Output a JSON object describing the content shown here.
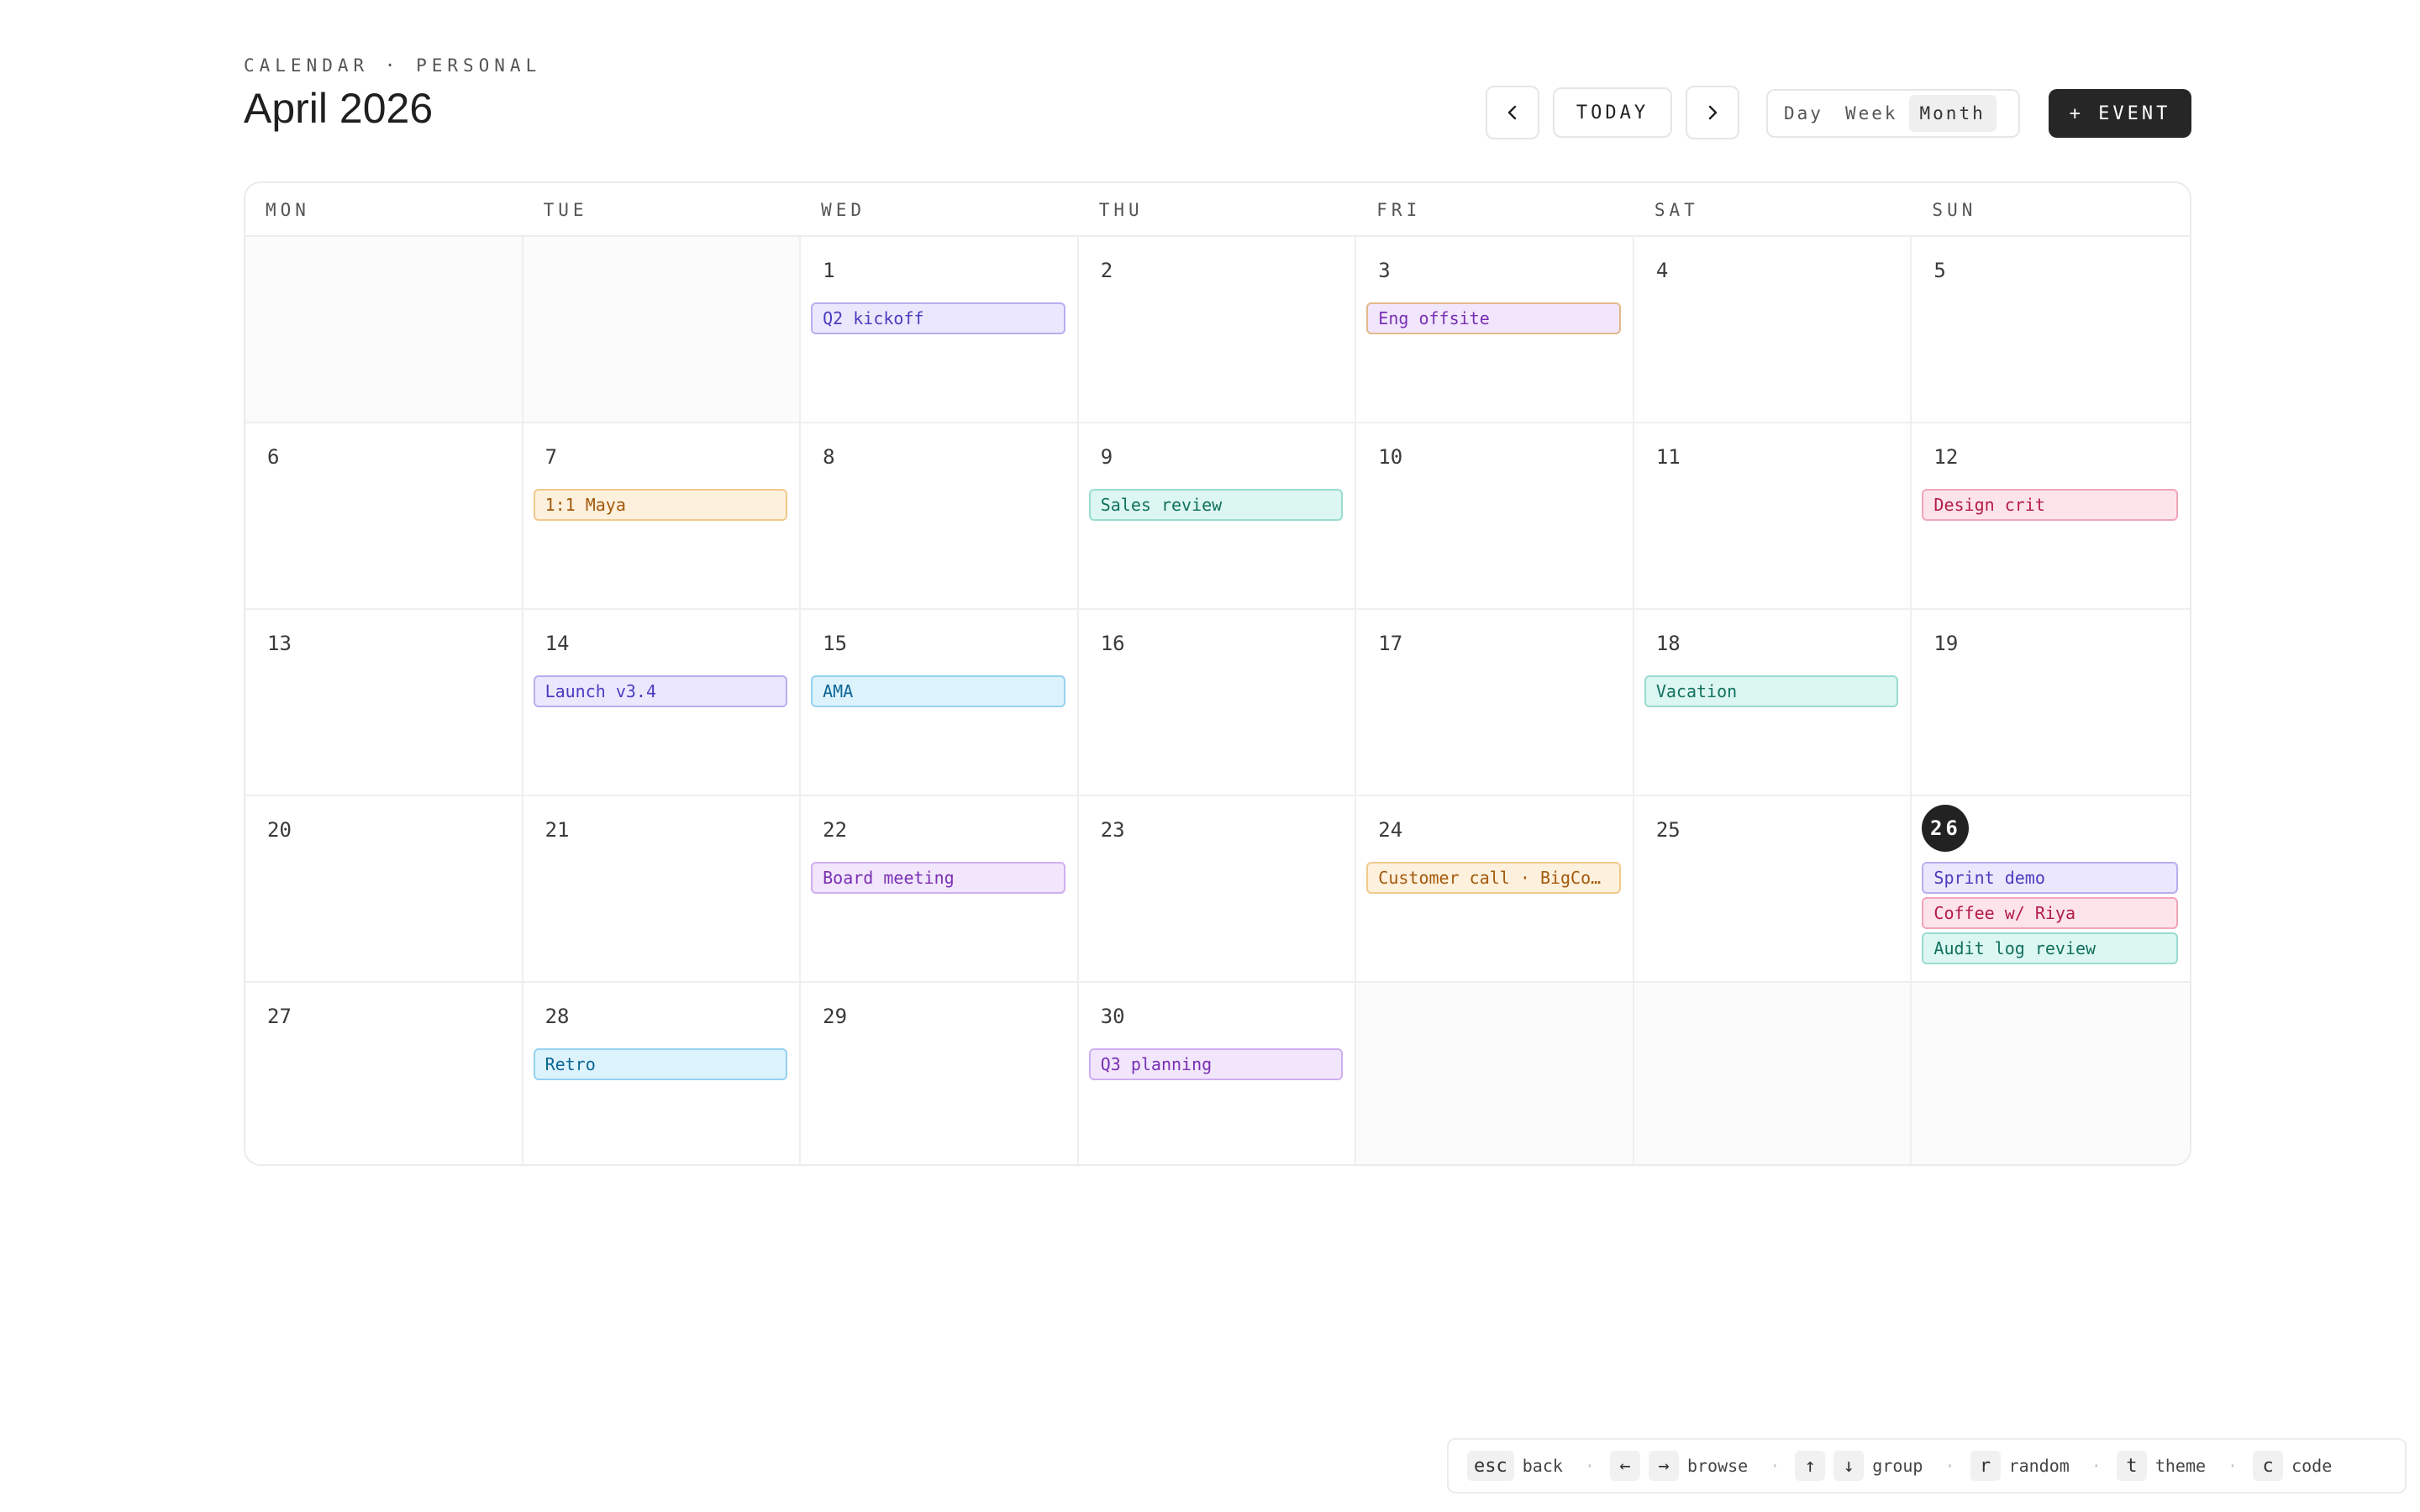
{
  "header": {
    "eyebrow": "CALENDAR · PERSONAL",
    "title": "April 2026"
  },
  "toolbar": {
    "prev_icon": "chevron-left-icon",
    "today_label": "TODAY",
    "next_icon": "chevron-right-icon",
    "views": [
      "Day",
      "Week",
      "Month"
    ],
    "active_view": "Month",
    "add_label": "+ EVENT"
  },
  "calendar": {
    "weekdays": [
      "MON",
      "TUE",
      "WED",
      "THU",
      "FRI",
      "SAT",
      "SUN"
    ],
    "today": "26",
    "weeks": [
      [
        {
          "day": "",
          "out": true,
          "events": []
        },
        {
          "day": "",
          "out": true,
          "events": []
        },
        {
          "day": "1",
          "events": [
            {
              "title": "Q2 kickoff",
              "color": "indigo"
            }
          ]
        },
        {
          "day": "2",
          "events": []
        },
        {
          "day": "3",
          "events": [
            {
              "title": "Eng offsite",
              "color": "purple-amber"
            }
          ]
        },
        {
          "day": "4",
          "events": []
        },
        {
          "day": "5",
          "events": []
        }
      ],
      [
        {
          "day": "6",
          "events": []
        },
        {
          "day": "7",
          "events": [
            {
              "title": "1:1 Maya",
              "color": "amber"
            }
          ]
        },
        {
          "day": "8",
          "events": []
        },
        {
          "day": "9",
          "events": [
            {
              "title": "Sales review",
              "color": "teal"
            }
          ]
        },
        {
          "day": "10",
          "events": []
        },
        {
          "day": "11",
          "events": []
        },
        {
          "day": "12",
          "events": [
            {
              "title": "Design crit",
              "color": "rose"
            }
          ]
        }
      ],
      [
        {
          "day": "13",
          "events": []
        },
        {
          "day": "14",
          "events": [
            {
              "title": "Launch v3.4",
              "color": "indigo"
            }
          ]
        },
        {
          "day": "15",
          "events": [
            {
              "title": "AMA",
              "color": "sky"
            }
          ]
        },
        {
          "day": "16",
          "events": []
        },
        {
          "day": "17",
          "events": []
        },
        {
          "day": "18",
          "events": [
            {
              "title": "Vacation",
              "color": "teal"
            }
          ]
        },
        {
          "day": "19",
          "events": []
        }
      ],
      [
        {
          "day": "20",
          "events": []
        },
        {
          "day": "21",
          "events": []
        },
        {
          "day": "22",
          "events": [
            {
              "title": "Board meeting",
              "color": "purple"
            }
          ]
        },
        {
          "day": "23",
          "events": []
        },
        {
          "day": "24",
          "events": [
            {
              "title": "Customer call · BigCo…",
              "color": "amber"
            }
          ]
        },
        {
          "day": "25",
          "events": []
        },
        {
          "day": "26",
          "events": [
            {
              "title": "Sprint demo",
              "color": "indigo"
            },
            {
              "title": "Coffee w/ Riya",
              "color": "rose"
            },
            {
              "title": "Audit log review",
              "color": "teal"
            }
          ]
        }
      ],
      [
        {
          "day": "27",
          "events": []
        },
        {
          "day": "28",
          "events": [
            {
              "title": "Retro",
              "color": "sky"
            }
          ]
        },
        {
          "day": "29",
          "events": []
        },
        {
          "day": "30",
          "events": [
            {
              "title": "Q3 planning",
              "color": "purple"
            }
          ]
        },
        {
          "day": "",
          "out": true,
          "events": []
        },
        {
          "day": "",
          "out": true,
          "events": []
        },
        {
          "day": "",
          "out": true,
          "events": []
        }
      ]
    ]
  },
  "palette": {
    "indigo": {
      "bg": "#ebe8fd",
      "border": "#b7aef0",
      "text": "#4a3cc0"
    },
    "purple": {
      "bg": "#f1e6fc",
      "border": "#cfaef0",
      "text": "#7a2fb3"
    },
    "purple-amber": {
      "bg": "#f1e6fc",
      "border": "#e3b98c",
      "text": "#7a2fb3"
    },
    "amber": {
      "bg": "#fdf0dc",
      "border": "#f0c98b",
      "text": "#a35a0c"
    },
    "teal": {
      "bg": "#dcf6f1",
      "border": "#98dcd0",
      "text": "#11725f"
    },
    "rose": {
      "bg": "#fde3ea",
      "border": "#f1a6b9",
      "text": "#b41c46"
    },
    "sky": {
      "bg": "#dcf2fd",
      "border": "#94d2f0",
      "text": "#0c6694"
    }
  },
  "hints": [
    {
      "keys": [
        "esc"
      ],
      "label": "back"
    },
    {
      "keys": [
        "←",
        "→"
      ],
      "label": "browse"
    },
    {
      "keys": [
        "↑",
        "↓"
      ],
      "label": "group"
    },
    {
      "keys": [
        "r"
      ],
      "label": "random"
    },
    {
      "keys": [
        "t"
      ],
      "label": "theme"
    },
    {
      "keys": [
        "c"
      ],
      "label": "code"
    }
  ]
}
